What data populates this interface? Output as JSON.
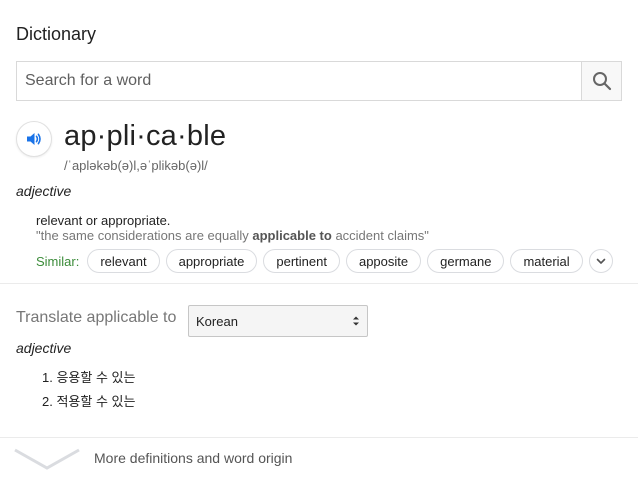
{
  "card": {
    "title": "Dictionary"
  },
  "search": {
    "placeholder": "Search for a word",
    "button_icon": "search-icon"
  },
  "entry": {
    "word": "ap·pli·ca·ble",
    "phonetic": "/ˈapləkəb(ə)l,əˈplikəb(ə)l/",
    "part_of_speech": "adjective",
    "definition": "relevant or appropriate.",
    "example_prefix": "\"the same considerations are equally ",
    "example_bold": "applicable to",
    "example_suffix": " accident claims\"",
    "similar_label": "Similar:",
    "similar": [
      "relevant",
      "appropriate",
      "pertinent",
      "apposite",
      "germane",
      "material"
    ]
  },
  "translate": {
    "label": "Translate applicable to",
    "language": "Korean",
    "part_of_speech": "adjective",
    "items": [
      "1. 응용할 수 있는",
      "2. 적용할 수 있는"
    ]
  },
  "footer": {
    "more_label": "More definitions and word origin"
  },
  "colors": {
    "similar_label": "#3c8c3a",
    "speaker_icon": "#1a73e8"
  }
}
